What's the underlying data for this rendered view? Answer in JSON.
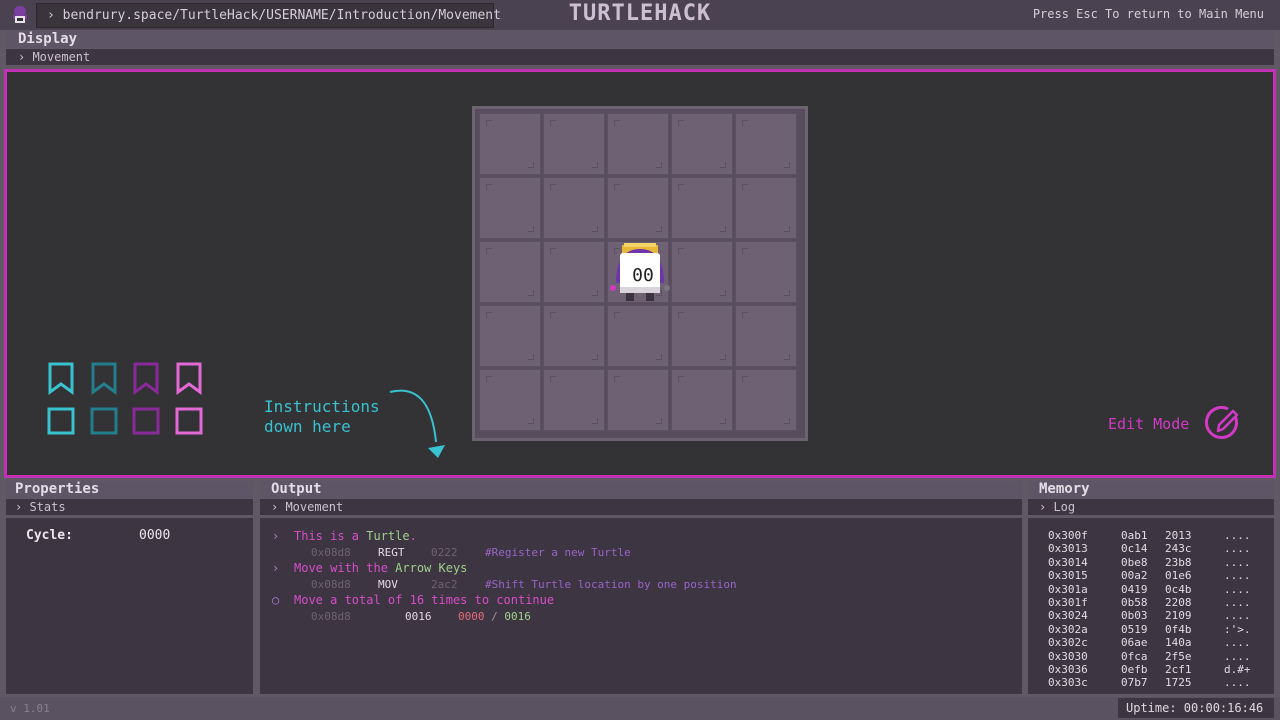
{
  "topbar": {
    "url": "› bendrury.space/TurtleHack/USERNAME/Introduction/Movement",
    "title": "TURTLEHACK",
    "esc_hint": "Press Esc To return to Main Menu"
  },
  "display": {
    "title": "Display",
    "breadcrumb": "› Movement",
    "grid": {
      "cols": 5,
      "rows": 5
    },
    "turtle": {
      "id": "00",
      "col": 2,
      "row": 2
    },
    "instructions_line1": "Instructions",
    "instructions_line2": "down here",
    "edit_mode_label": "Edit Mode",
    "palette": [
      "#39c2d0",
      "#237f8c",
      "#8a2a9a",
      "#e36ad6"
    ]
  },
  "properties": {
    "title": "Properties",
    "breadcrumb": "› Stats",
    "cycle_label": "Cycle:",
    "cycle_value": "0000"
  },
  "output": {
    "title": "Output",
    "breadcrumb": "› Movement",
    "lines": [
      {
        "marker": "›",
        "pre": "This is a ",
        "hl": "Turtle",
        "post": ".",
        "addr": "0x08d8",
        "op": "REGT",
        "arg": "0222",
        "comment": "#Register a new Turtle"
      },
      {
        "marker": "›",
        "pre": "Move with the ",
        "hl": "Arrow Keys",
        "post": "",
        "addr": "0x08d8",
        "op": "MOV",
        "arg": "2ac2",
        "comment": "#Shift Turtle location by one position"
      },
      {
        "marker": "○",
        "pre": "Move a total of 16 times to continue",
        "hl": "",
        "post": "",
        "addr": "0x08d8",
        "op": "0016",
        "current": "0000",
        "slash": "/",
        "total": "0016"
      }
    ]
  },
  "memory": {
    "title": "Memory",
    "breadcrumb": "› Log",
    "rows": [
      [
        "0x300f",
        "0ab1",
        "2013",
        "...."
      ],
      [
        "0x3013",
        "0c14",
        "243c",
        "...."
      ],
      [
        "0x3014",
        "0be8",
        "23b8",
        "...."
      ],
      [
        "0x3015",
        "00a2",
        "01e6",
        "...."
      ],
      [
        "0x301a",
        "0419",
        "0c4b",
        "...."
      ],
      [
        "0x301f",
        "0b58",
        "2208",
        "...."
      ],
      [
        "0x3024",
        "0b03",
        "2109",
        "...."
      ],
      [
        "0x302a",
        "0519",
        "0f4b",
        ":'>."
      ],
      [
        "0x302c",
        "06ae",
        "140a",
        "...."
      ],
      [
        "0x3030",
        "0fca",
        "2f5e",
        "...."
      ],
      [
        "0x3036",
        "0efb",
        "2cf1",
        "d.#+"
      ],
      [
        "0x303c",
        "07b7",
        "1725",
        "...."
      ]
    ]
  },
  "status": {
    "version": "v 1.01",
    "uptime": "Uptime: 00:00:16:46"
  }
}
